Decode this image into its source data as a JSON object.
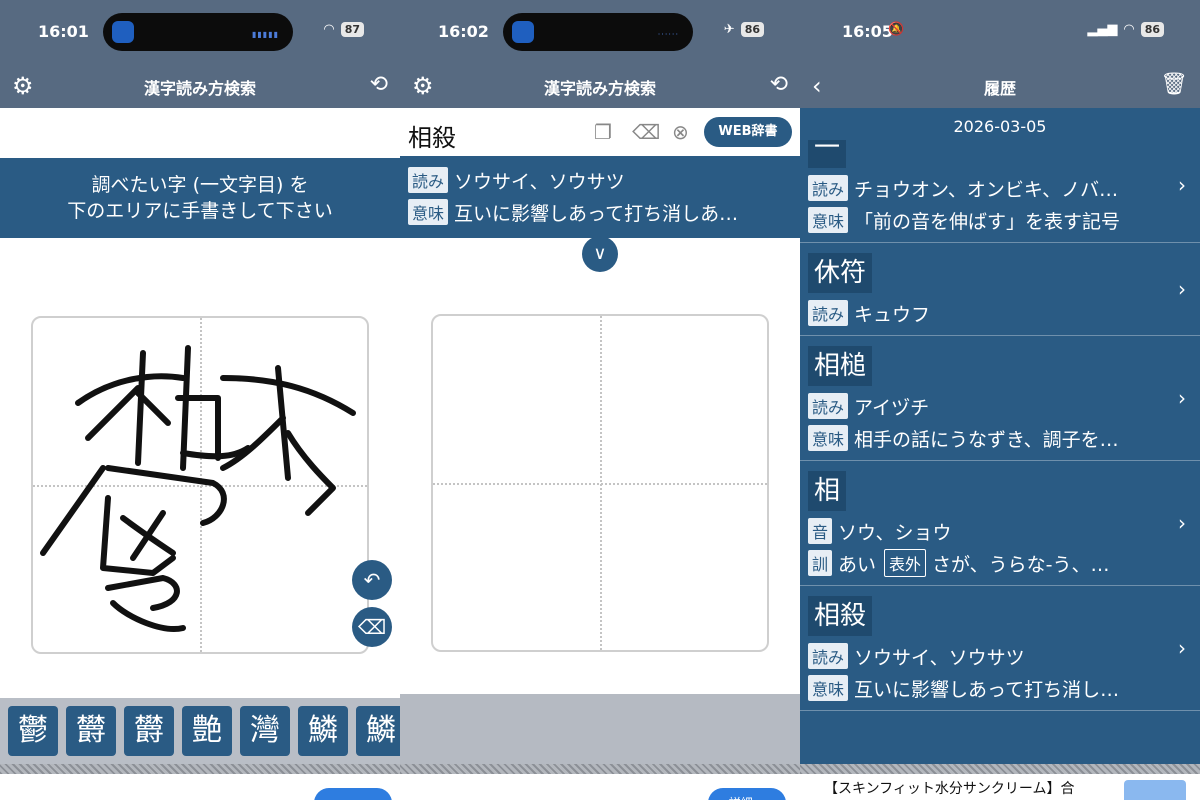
{
  "panel1": {
    "status": {
      "time": "16:01",
      "battery": "87"
    },
    "nav": {
      "title": "漢字読み方検索"
    },
    "instruction": {
      "line1": "調べたい字 (一文字目) を",
      "line2": "下のエリアに手書きして下さい"
    },
    "candidates": [
      "鬱",
      "欝",
      "欝",
      "艶",
      "灣",
      "鱗",
      "鱗"
    ]
  },
  "panel2": {
    "status": {
      "time": "16:02",
      "battery": "86"
    },
    "nav": {
      "title": "漢字読み方検索"
    },
    "search": {
      "value": "相殺",
      "web_button": "WEB辞書"
    },
    "result": {
      "yomi_tag": "読み",
      "yomi": "ソウサイ、ソウサツ",
      "imi_tag": "意味",
      "imi": "互いに影響しあって打ち消しあ…"
    },
    "bottom_button": "詳細 ∧"
  },
  "panel3": {
    "status": {
      "time": "16:05",
      "battery": "86"
    },
    "nav": {
      "title": "履歴"
    },
    "date": "2026-03-05",
    "items": [
      {
        "kanji": "一",
        "tag1": "読み",
        "text1": "チョウオン、オンビキ、ノバ…",
        "tag2": "意味",
        "text2": "「前の音を伸ばす」を表す記号"
      },
      {
        "kanji": "休符",
        "tag1": "読み",
        "text1": "キュウフ"
      },
      {
        "kanji": "相槌",
        "tag1": "読み",
        "text1": "アイヅチ",
        "tag2": "意味",
        "text2": "相手の話にうなずき、調子を…"
      },
      {
        "kanji": "相",
        "tag1": "音",
        "text1": "ソウ、ショウ",
        "tag2": "訓",
        "text2a": "あい",
        "tag3": "表外",
        "text2b": "さが、うらな-う、…"
      },
      {
        "kanji": "相殺",
        "tag1": "読み",
        "text1": "ソウサイ、ソウサツ",
        "tag2": "意味",
        "text2": "互いに影響しあって打ち消し…"
      }
    ],
    "ad": {
      "text": "【スキンフィット水分サンクリーム】合",
      "button": ""
    }
  }
}
